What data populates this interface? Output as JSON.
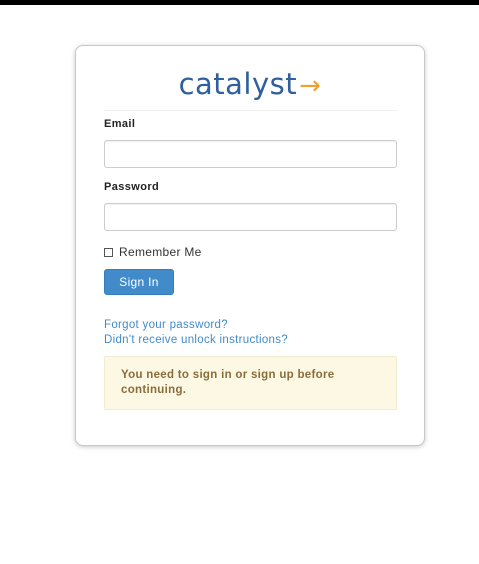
{
  "brand": {
    "name": "catalyst",
    "arrow": "→"
  },
  "form": {
    "email_label": "Email",
    "email_value": "",
    "password_label": "Password",
    "password_value": "",
    "remember_label": "Remember Me",
    "remember_checked": false,
    "submit_label": "Sign In"
  },
  "links": {
    "forgot_password": "Forgot your password?",
    "unlock_instructions": "Didn't receive unlock instructions?"
  },
  "alert": {
    "message": "You need to sign in or sign up before continuing."
  },
  "colors": {
    "brand_blue": "#2f5f9c",
    "brand_arrow": "#f0a030",
    "button_primary": "#428bca",
    "link": "#428bca",
    "alert_bg": "#fcf8e3",
    "alert_text": "#8a6d3b"
  }
}
